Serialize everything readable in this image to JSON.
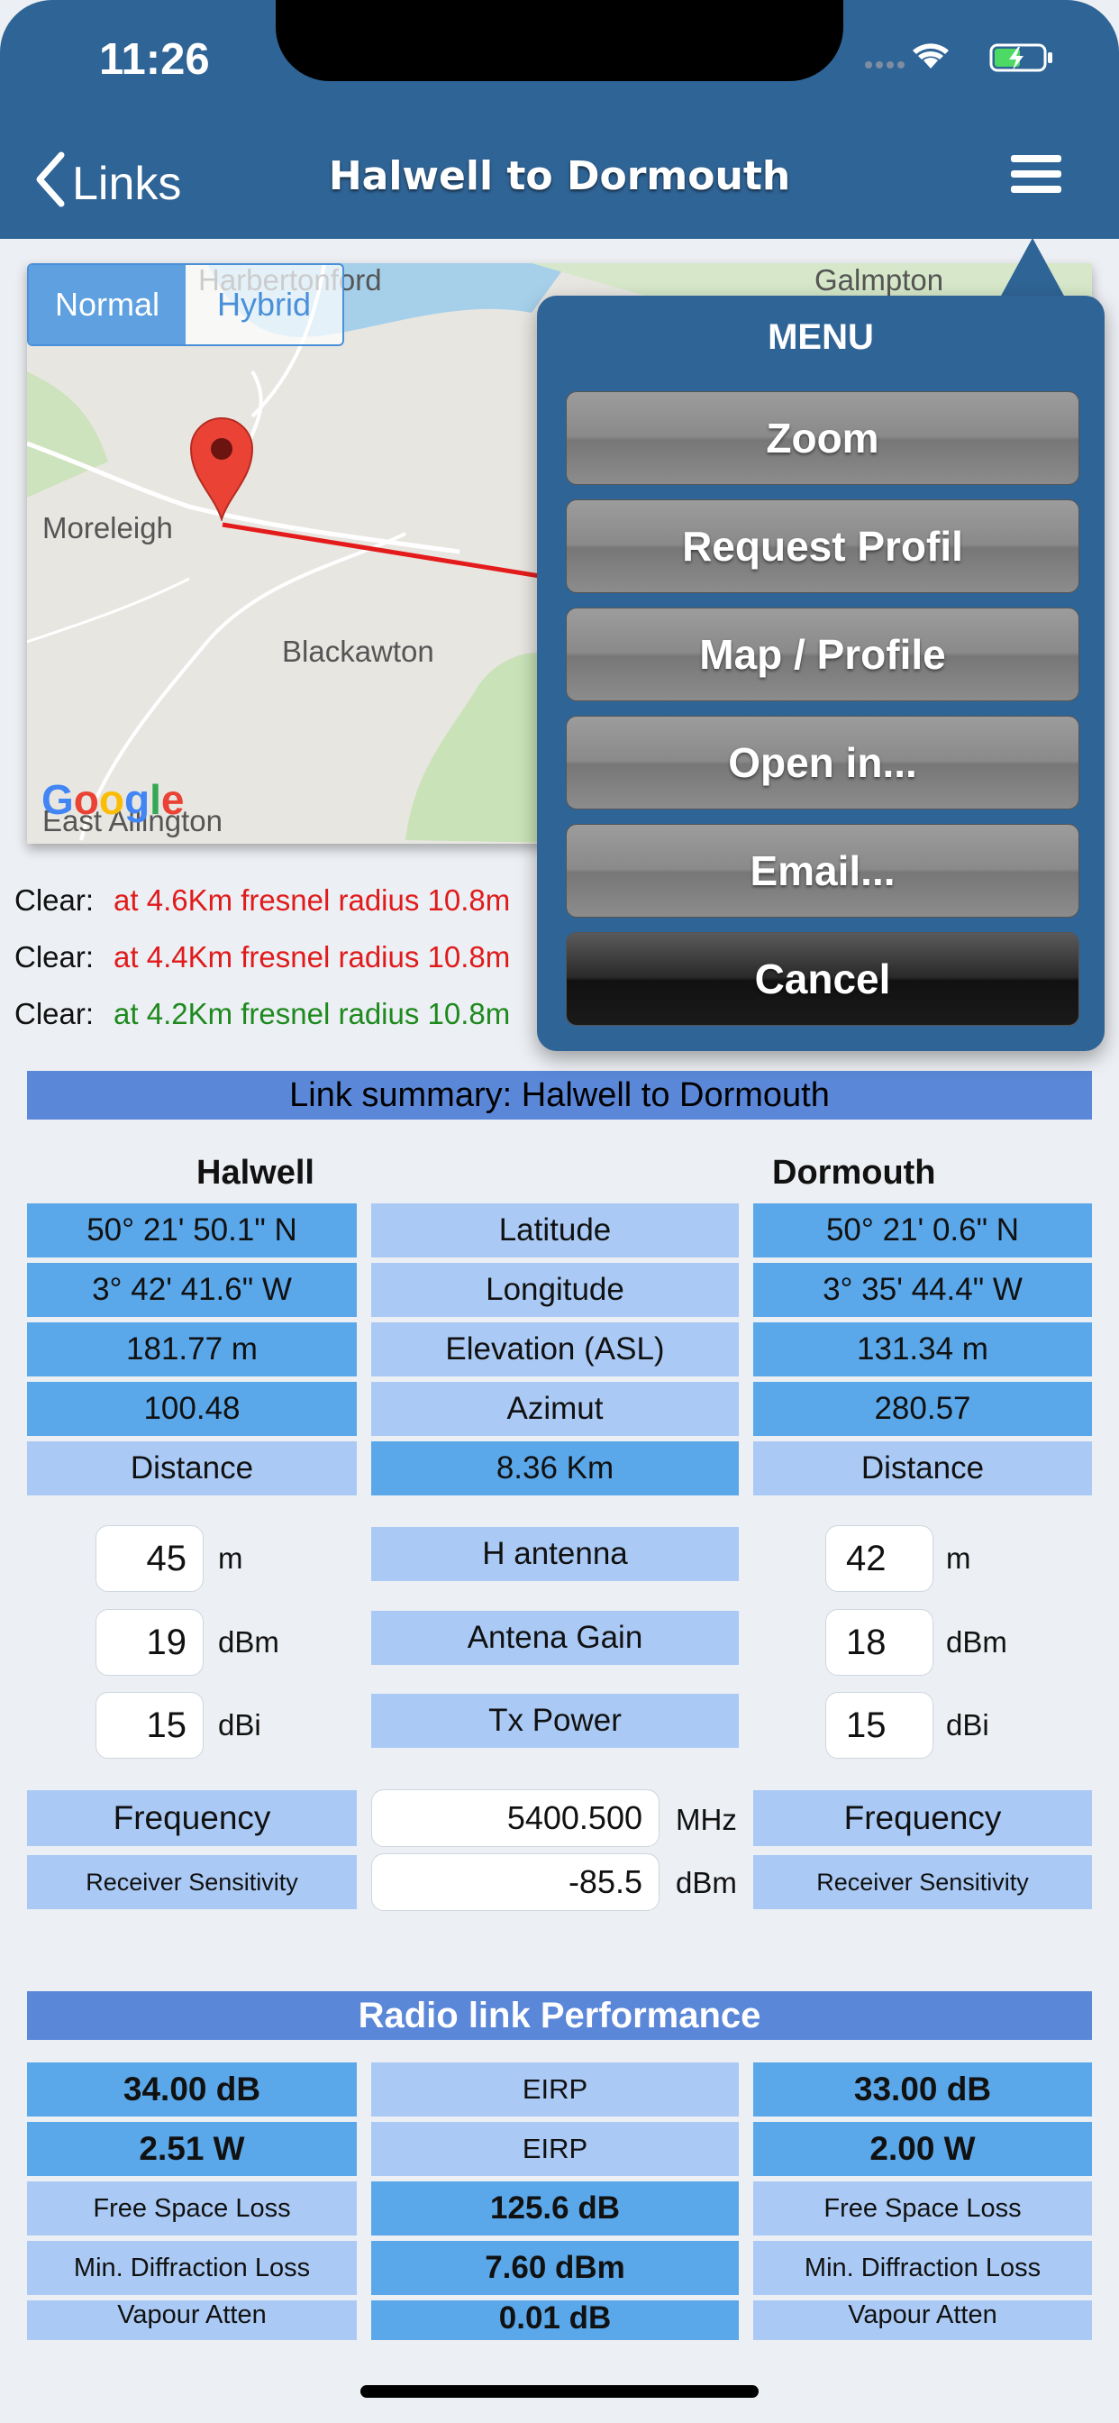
{
  "status": {
    "time": "11:26"
  },
  "nav": {
    "back_label": "Links",
    "title": "Halwell to Dormouth"
  },
  "map": {
    "segments": [
      "Normal",
      "Hybrid"
    ],
    "places": [
      "Harbertonford",
      "Galmpton",
      "Moreleigh",
      "Blackawton",
      "East Allington"
    ],
    "logo": "Google"
  },
  "clearance": [
    {
      "label": "Clear:",
      "text": "at 4.6Km  fresnel radius 10.8m",
      "color": "red"
    },
    {
      "label": "Clear:",
      "text": "at 4.4Km  fresnel radius 10.8m",
      "color": "red"
    },
    {
      "label": "Clear:",
      "text": "at 4.2Km fresnel radius 10.8m",
      "color": "green"
    }
  ],
  "summary": {
    "header": "Link summary: Halwell to Dormouth",
    "site_a": "Halwell",
    "site_b": "Dormouth",
    "rows": [
      {
        "a": "50° 21' 50.1\" N",
        "mid": "Latitude",
        "b": "50° 21' 0.6\" N"
      },
      {
        "a": "3° 42' 41.6\" W",
        "mid": "Longitude",
        "b": "3° 35' 44.4\" W"
      },
      {
        "a": "181.77 m",
        "mid": "Elevation (ASL)",
        "b": "131.34 m"
      },
      {
        "a": "100.48",
        "mid": "Azimut",
        "b": "280.57"
      },
      {
        "a": "Distance",
        "mid": "8.36 Km",
        "b": "Distance"
      }
    ],
    "inputs": [
      {
        "a": "45",
        "unit": "m",
        "mid": "H antenna",
        "b": "42"
      },
      {
        "a": "19",
        "unit": "dBm",
        "mid": "Antena Gain",
        "b": "18"
      },
      {
        "a": "15",
        "unit": "dBi",
        "mid": "Tx Power",
        "b": "15"
      }
    ],
    "frequency": {
      "label": "Frequency",
      "value": "5400.500",
      "unit": "MHz"
    },
    "sensitivity": {
      "label": "Receiver Sensitivity",
      "value": "-85.5",
      "unit": "dBm"
    }
  },
  "performance": {
    "header": "Radio link Performance",
    "rows": [
      {
        "a": "34.00 dB",
        "mid": "EIRP",
        "b": "33.00 dB"
      },
      {
        "a": "2.51 W",
        "mid": "EIRP",
        "b": "2.00 W"
      },
      {
        "a": "Free Space Loss",
        "mid": "125.6 dB",
        "b": "Free Space Loss"
      },
      {
        "a": "Min. Diffraction Loss",
        "mid": "7.60 dBm",
        "b": "Min. Diffraction Loss"
      },
      {
        "a": "Vapour Atten",
        "mid": "0.01 dB",
        "b": "Vapour Atten"
      }
    ]
  },
  "menu": {
    "title": "MENU",
    "items": [
      "Zoom",
      "Request Profil",
      "Map / Profile",
      "Open in...",
      "Email...",
      "Cancel"
    ]
  }
}
